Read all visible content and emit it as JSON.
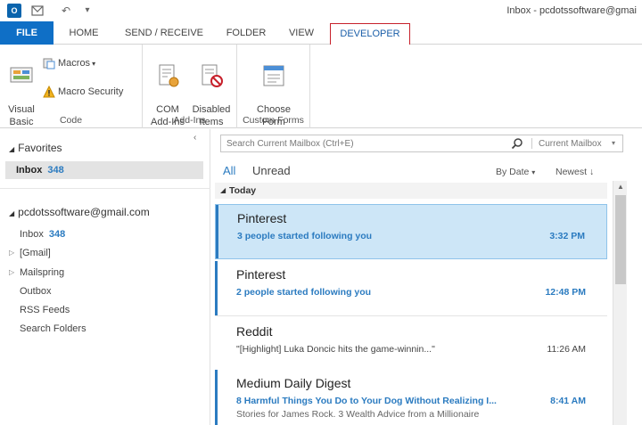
{
  "window": {
    "title": "Inbox - pcdotssoftware@gmai",
    "app_icon_label": "O",
    "qat": {
      "send_receive_icon": "send-receive-icon",
      "undo_glyph": "↶",
      "customize_glyph": "▾"
    }
  },
  "tabs": [
    {
      "label": "FILE"
    },
    {
      "label": "HOME"
    },
    {
      "label": "SEND / RECEIVE"
    },
    {
      "label": "FOLDER"
    },
    {
      "label": "VIEW"
    },
    {
      "label": "DEVELOPER"
    }
  ],
  "ribbon": {
    "code": {
      "label": "Code",
      "visual_basic": "Visual\nBasic",
      "macros": "Macros",
      "macro_security": "Macro Security"
    },
    "addins": {
      "label": "Add-Ins",
      "com_addins": "COM\nAdd-Ins",
      "disabled_items": "Disabled\nItems"
    },
    "custom_forms": {
      "label": "Custom Forms",
      "choose_form": "Choose\nForm"
    }
  },
  "folder_pane": {
    "collapse_glyph": "‹",
    "favorites": {
      "header": "Favorites",
      "inbox_label": "Inbox",
      "inbox_count": "348"
    },
    "account": {
      "header": "pcdotssoftware@gmail.com",
      "folders": [
        {
          "label": "Inbox",
          "count": "348"
        },
        {
          "label": "[Gmail]"
        },
        {
          "label": "Mailspring"
        },
        {
          "label": "Outbox"
        },
        {
          "label": "RSS Feeds"
        },
        {
          "label": "Search Folders"
        }
      ]
    }
  },
  "message_list": {
    "search": {
      "placeholder": "Search Current Mailbox (Ctrl+E)",
      "scope": "Current Mailbox"
    },
    "filters": {
      "all": "All",
      "unread": "Unread"
    },
    "sort": {
      "by": "By Date",
      "order": "Newest"
    },
    "group_header": "Today",
    "messages": [
      {
        "sender": "Pinterest",
        "subject": "3 people started following you",
        "time": "3:32 PM",
        "preview": "",
        "unread": true,
        "selected": true
      },
      {
        "sender": "Pinterest",
        "subject": "2 people started following you",
        "time": "12:48 PM",
        "preview": "",
        "unread": true,
        "selected": false
      },
      {
        "sender": "Reddit",
        "subject": "\"[Highlight] Luka Doncic hits the game-winnin...\"",
        "time": "11:26 AM",
        "preview": "",
        "unread": false,
        "selected": false
      },
      {
        "sender": "Medium Daily Digest",
        "subject": "8 Harmful Things You Do to Your Dog Without Realizing I...",
        "time": "8:41 AM",
        "preview": "Stories for James Rock. 3 Wealth Advice from a Millionaire",
        "unread": true,
        "selected": false
      }
    ]
  },
  "colors": {
    "accent": "#2b7bc0",
    "file_tab": "#0f6fc6",
    "highlight_border": "#c7202b",
    "selection": "#cde6f7"
  }
}
